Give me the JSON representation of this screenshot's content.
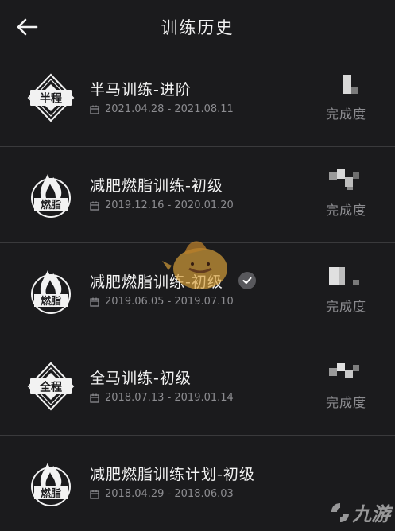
{
  "header": {
    "title": "训练历史"
  },
  "rows": [
    {
      "name": "半马训练-进阶",
      "date": "2021.04.28 - 2021.08.11",
      "badge": "半程",
      "badge_type": "seal",
      "progress_label": "完成度",
      "completed": false
    },
    {
      "name": "减肥燃脂训练-初级",
      "date": "2019.12.16 - 2020.01.20",
      "badge": "燃脂",
      "badge_type": "flame",
      "progress_label": "完成度",
      "completed": false
    },
    {
      "name": "减肥燃脂训练-初级",
      "date": "2019.06.05 - 2019.07.10",
      "badge": "燃脂",
      "badge_type": "flame",
      "progress_label": "完成度",
      "completed": true
    },
    {
      "name": "全马训练-初级",
      "date": "2018.07.13 - 2019.01.14",
      "badge": "全程",
      "badge_type": "seal",
      "progress_label": "完成度",
      "completed": false
    },
    {
      "name": "减肥燃脂训练计划-初级",
      "date": "2018.04.29 - 2018.06.03",
      "badge": "燃脂",
      "badge_type": "flame",
      "progress_label": "完成度",
      "completed": false
    }
  ],
  "watermark": {
    "logo_text": "九游"
  },
  "icons": {
    "back": "back-arrow-icon",
    "date": "calendar-icon",
    "completed": "checkmark-icon"
  },
  "colors": {
    "background": "#1b1b1d",
    "divider": "#3a3a3c",
    "muted_text": "#8c8c90",
    "check_bg": "#58585c"
  }
}
